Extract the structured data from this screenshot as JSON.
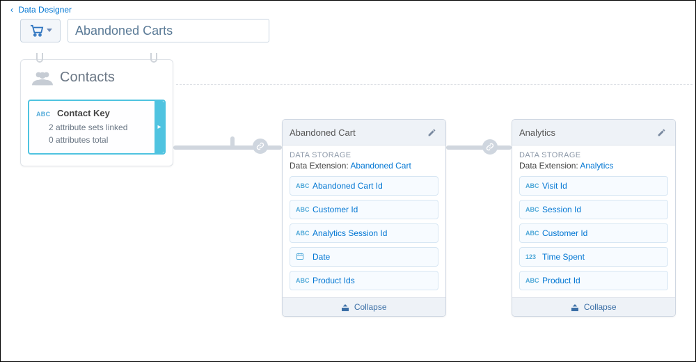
{
  "breadcrumb": {
    "label": "Data Designer"
  },
  "toolbar": {
    "icon": "cart-icon",
    "title_value": "Abandoned Carts"
  },
  "contacts": {
    "title": "Contacts",
    "key": {
      "type_icon": "ABC",
      "label": "Contact Key",
      "line1": "2 attribute sets linked",
      "line2": "0 attributes total"
    }
  },
  "cards": [
    {
      "name": "Abandoned Cart",
      "storage_label": "DATA STORAGE",
      "storage_prefix": "Data Extension: ",
      "storage_link": "Abandoned Cart",
      "fields": [
        {
          "type": "ABC",
          "label": "Abandoned Cart Id"
        },
        {
          "type": "ABC",
          "label": "Customer Id"
        },
        {
          "type": "ABC",
          "label": "Analytics Session Id"
        },
        {
          "type": "DATE",
          "label": "Date"
        },
        {
          "type": "ABC",
          "label": "Product Ids"
        }
      ],
      "collapse": "Collapse"
    },
    {
      "name": "Analytics",
      "storage_label": "DATA STORAGE",
      "storage_prefix": "Data Extension: ",
      "storage_link": "Analytics",
      "fields": [
        {
          "type": "ABC",
          "label": "Visit Id"
        },
        {
          "type": "ABC",
          "label": "Session Id"
        },
        {
          "type": "ABC",
          "label": "Customer Id"
        },
        {
          "type": "123",
          "label": "Time Spent"
        },
        {
          "type": "ABC",
          "label": "Product Id"
        }
      ],
      "collapse": "Collapse"
    }
  ]
}
